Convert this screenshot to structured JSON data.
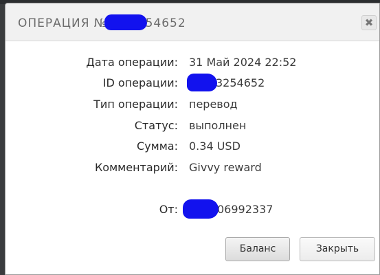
{
  "dialog": {
    "title_prefix": "ОПЕРАЦИЯ №",
    "title_suffix": "54652",
    "close_glyph": "✖"
  },
  "details": {
    "date_label": "Дата операции:",
    "date_value": "31 Май 2024 22:52",
    "id_label": "ID операции:",
    "id_value_visible": "3254652",
    "type_label": "Тип операции:",
    "type_value": "перевод",
    "status_label": "Статус:",
    "status_value": "выполнен",
    "amount_label": "Сумма:",
    "amount_value": "0.34 USD",
    "comment_label": "Комментарий:",
    "comment_value": "Givvy reward",
    "from_label": "От:",
    "from_value_visible": "06992337"
  },
  "buttons": {
    "balance": "Баланс",
    "close": "Закрыть"
  },
  "colors": {
    "redaction": "#1212ee"
  }
}
